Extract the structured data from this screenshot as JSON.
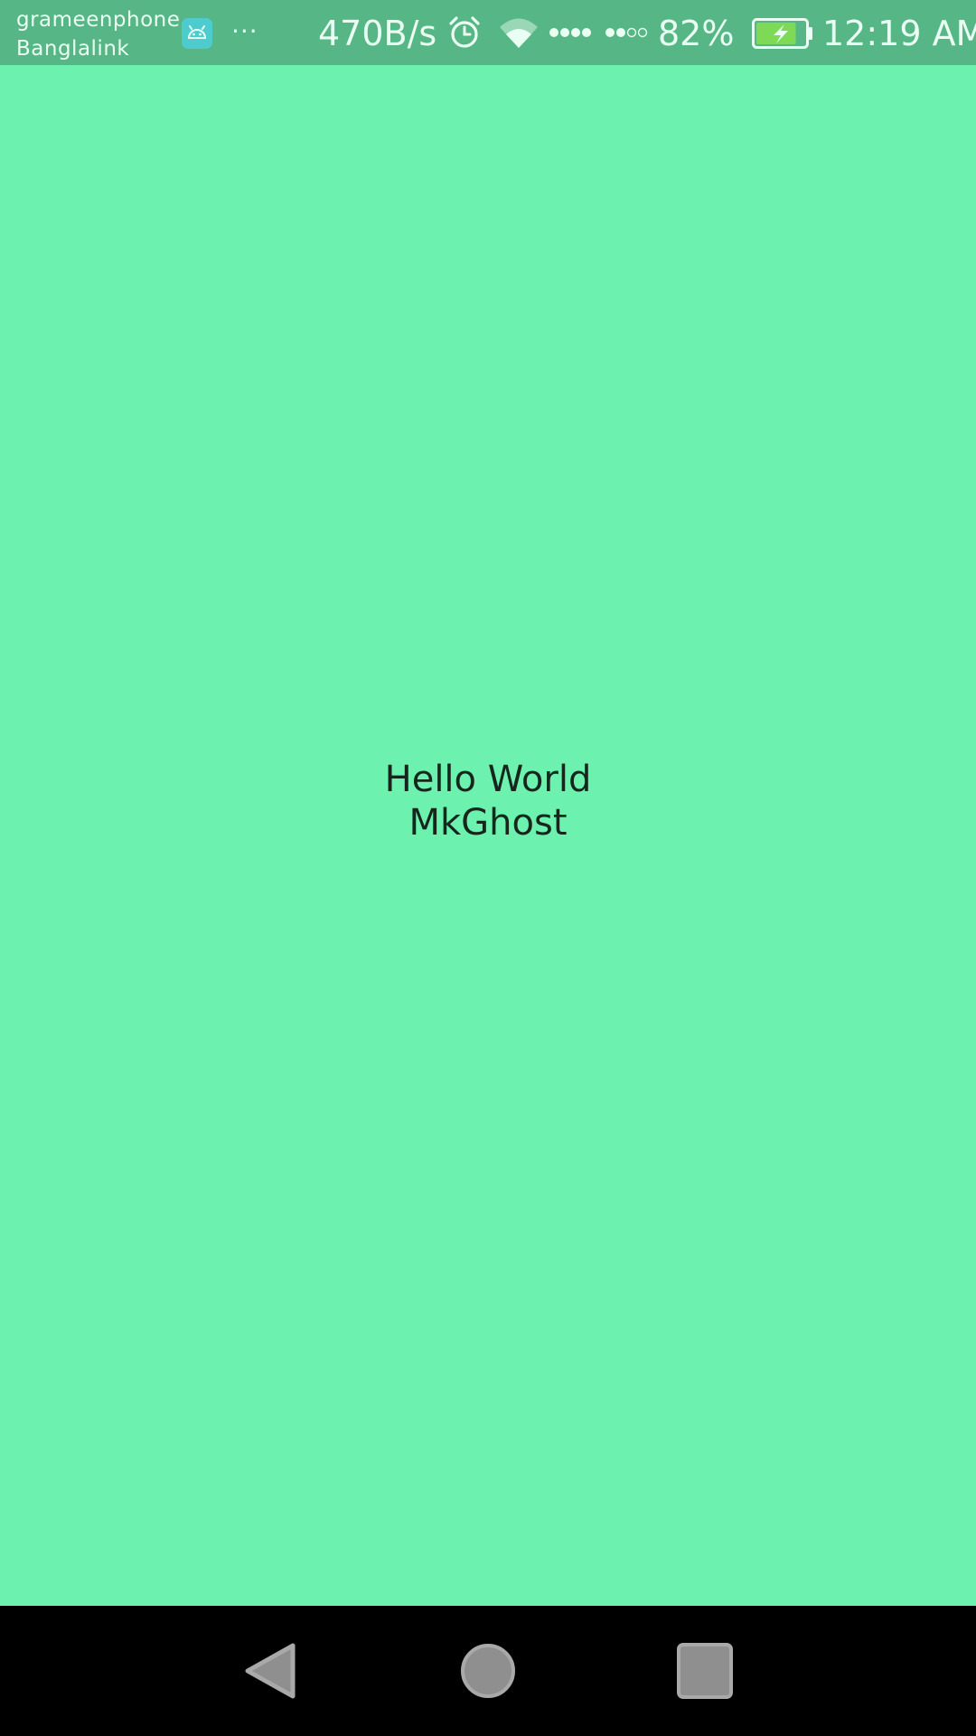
{
  "status_bar": {
    "carrier_1": "grameenphone",
    "carrier_2": "Banglalink",
    "more": "···",
    "net_speed": "470B/s",
    "battery_percent": "82%",
    "time": "12:19 AM",
    "battery_level": 0.82,
    "charging": true,
    "icons": [
      "android-icon",
      "more-icon",
      "alarm-icon",
      "wifi-icon",
      "signal-icon",
      "battery-icon"
    ],
    "colors": {
      "background": "#57b685",
      "foreground": "#eafff3",
      "android_badge": "#4ecbcf",
      "battery_fill": "#7ed957"
    }
  },
  "main": {
    "line_1": "Hello World",
    "line_2": "MkGhost",
    "background_color": "#6cf2ae",
    "text_color": "#15271d"
  },
  "nav_bar": {
    "icons": [
      "back-icon",
      "home-icon",
      "recents-icon"
    ],
    "background_color": "#000000"
  }
}
